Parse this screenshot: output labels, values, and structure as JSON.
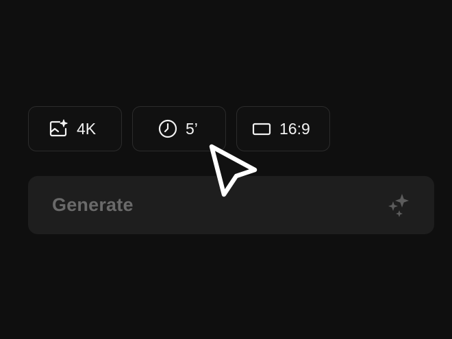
{
  "options": {
    "quality": {
      "label": "4K",
      "icon": "image-sparkle-icon"
    },
    "duration": {
      "label": "5’",
      "icon": "clock-icon"
    },
    "aspect_ratio": {
      "label": "16:9",
      "icon": "rectangle-icon"
    }
  },
  "generate": {
    "label": "Generate",
    "icon": "sparkles-icon",
    "state": "disabled"
  },
  "cursor": {
    "icon": "mouse-pointer-icon"
  },
  "colors": {
    "background": "#0f0f0f",
    "chip_border": "#2c2c2c",
    "chip_text": "#f2f2f2",
    "generate_bg": "#1e1e1e",
    "generate_text": "#6a6a6a"
  }
}
